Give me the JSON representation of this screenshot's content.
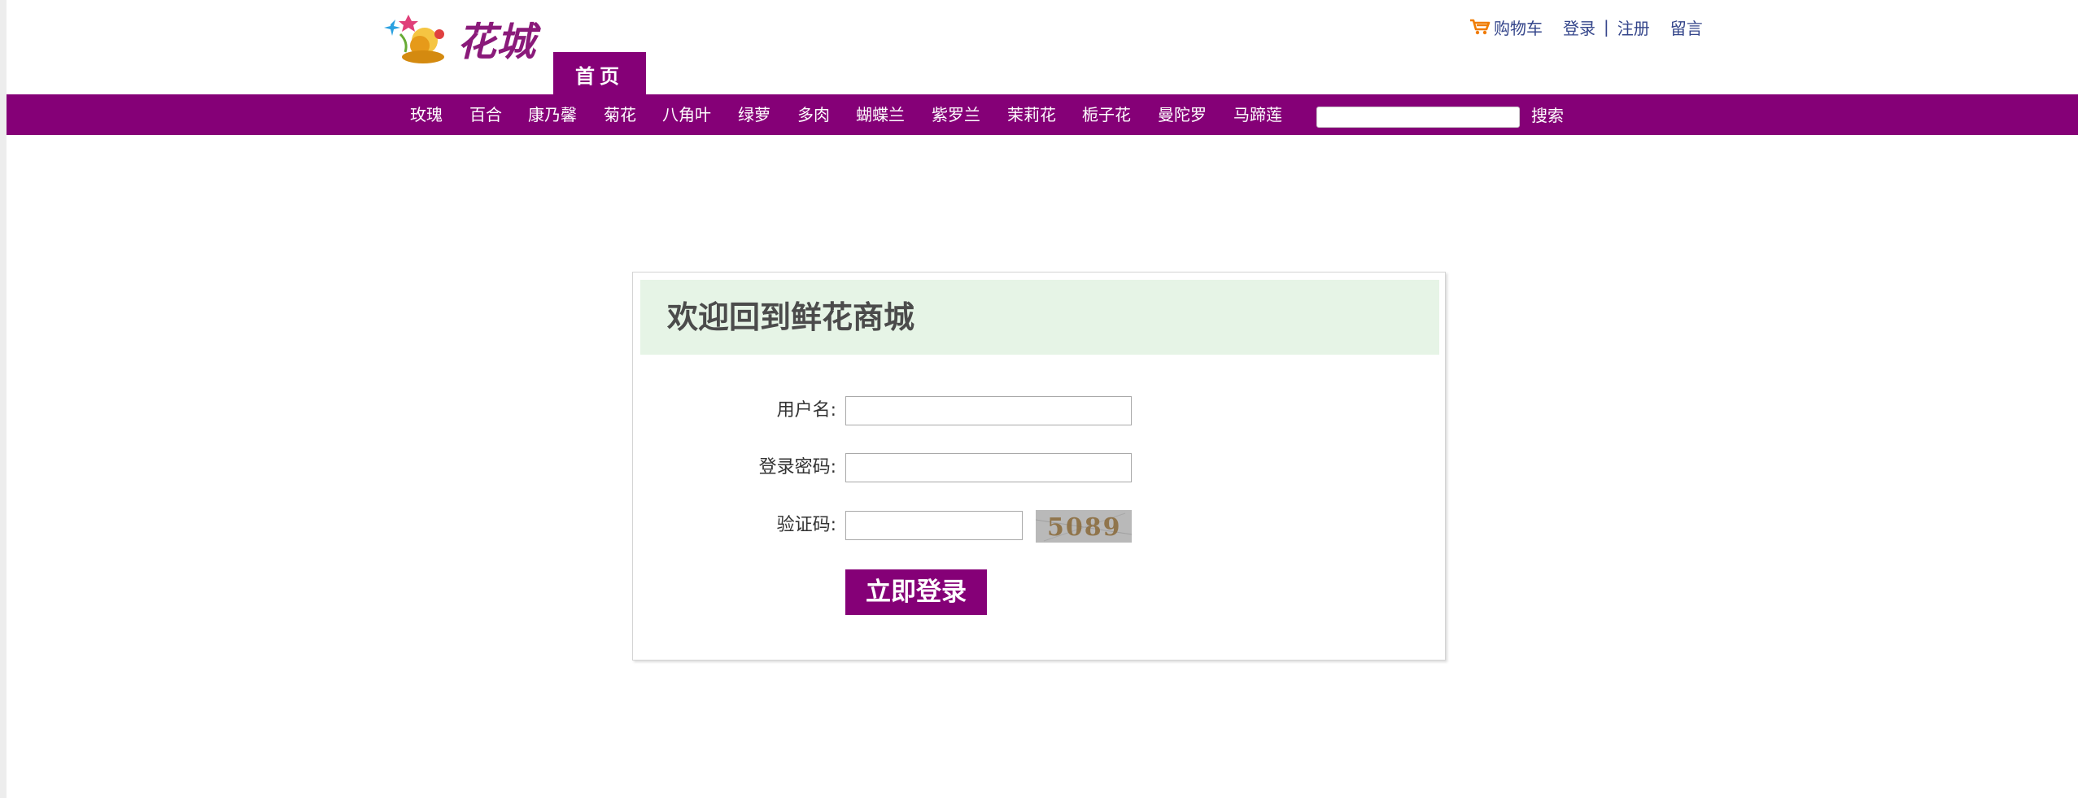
{
  "header": {
    "logo_text": "花城",
    "home_tab": "首页"
  },
  "toplinks": {
    "cart": "购物车",
    "login": "登录",
    "separator": "|",
    "register": "注册",
    "message": "留言"
  },
  "nav": {
    "items": [
      "玫瑰",
      "百合",
      "康乃馨",
      "菊花",
      "八角叶",
      "绿萝",
      "多肉",
      "蝴蝶兰",
      "紫罗兰",
      "茉莉花",
      "栀子花",
      "曼陀罗",
      "马蹄莲"
    ],
    "search_placeholder": "",
    "search_button": "搜索"
  },
  "login": {
    "title": "欢迎回到鲜花商城",
    "username_label": "用户名:",
    "username_value": "",
    "password_label": "登录密码:",
    "password_value": "",
    "captcha_label": "验证码:",
    "captcha_value": "",
    "captcha_text": "5089",
    "submit": "立即登录"
  },
  "colors": {
    "brand_purple": "#850077",
    "header_green": "#e6f4e6",
    "link_blue": "#35468b",
    "cart_orange": "#f07c00"
  }
}
